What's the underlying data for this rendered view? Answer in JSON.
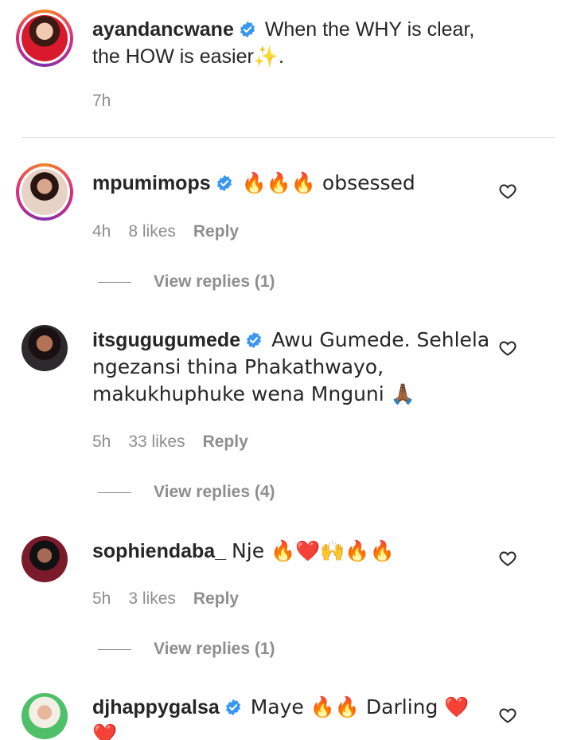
{
  "caption": {
    "username": "ayandancwane",
    "text": "When the WHY is clear, the HOW is easier✨.",
    "time": "7h"
  },
  "comments": [
    {
      "username": "mpumimops",
      "verified": true,
      "text": "🔥🔥🔥 obsessed",
      "time": "4h",
      "likes": "8 likes",
      "reply_label": "Reply",
      "view_replies": "View replies (1)"
    },
    {
      "username": "itsgugugumede",
      "verified": true,
      "text": "Awu Gumede. Sehlela ngezansi thina Phakathwayo, makukhuphuke wena Mnguni 🙏🏾",
      "time": "5h",
      "likes": "33 likes",
      "reply_label": "Reply",
      "view_replies": "View replies (4)"
    },
    {
      "username": "sophiendaba_",
      "verified": false,
      "text": "Nje 🔥❤️🙌🔥🔥",
      "time": "5h",
      "likes": "3 likes",
      "reply_label": "Reply",
      "view_replies": "View replies (1)"
    },
    {
      "username": "djhappygalsa",
      "verified": true,
      "text": "Maye 🔥🔥 Darling ❤️❤️"
    }
  ],
  "icons": {
    "verified": "verified-badge-icon",
    "like": "heart-outline-icon"
  },
  "colors": {
    "verified_blue": "#3897f0",
    "meta_gray": "#8e8e8e",
    "text": "#262626"
  }
}
